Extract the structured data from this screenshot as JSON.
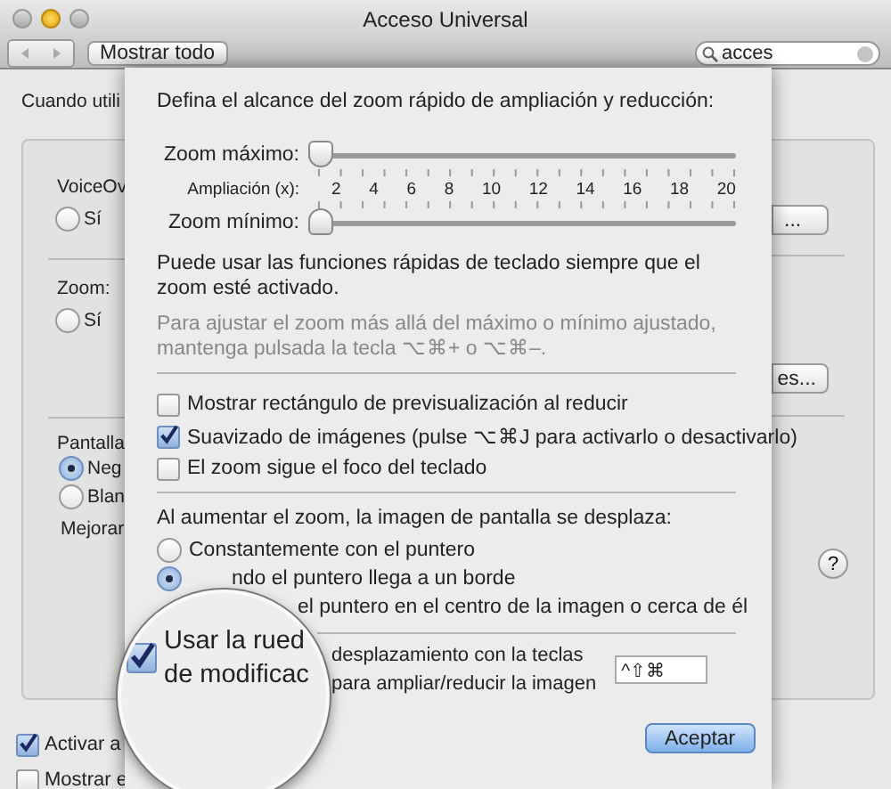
{
  "window": {
    "title": "Acceso Universal"
  },
  "toolbar": {
    "show_all_button": "Mostrar todo",
    "search": {
      "value": "acces"
    }
  },
  "background": {
    "intro": "Cuando utili",
    "voiceover": {
      "label": "VoiceOv",
      "radio": {
        "label": "Sí",
        "selected": false
      },
      "button": "..."
    },
    "zoom": {
      "label": "Zoom:",
      "radio": {
        "label": "Sí",
        "selected": false
      },
      "button": "es..."
    },
    "display": {
      "label": "Pantalla",
      "radios": [
        {
          "label": "Neg",
          "selected": true
        },
        {
          "label": "Blan",
          "selected": false
        }
      ],
      "enhance_label": "Mejorar"
    },
    "help_button": "?",
    "checkboxes": [
      {
        "label": "Activar a",
        "checked": true
      },
      {
        "label": "Mostrar e",
        "checked": false
      }
    ]
  },
  "sheet": {
    "range_heading": "Defina el alcance del zoom rápido de ampliación y reducción:",
    "sliders": [
      {
        "label": "Zoom máximo:",
        "level": 0
      },
      {
        "label": "Zoom mínimo:",
        "level": 0
      }
    ],
    "scale": {
      "label": "Ampliación (x):",
      "ticks": [
        "2",
        "4",
        "6",
        "8",
        "10",
        "12",
        "14",
        "16",
        "18",
        "20"
      ]
    },
    "note": "Puede usar las funciones rápidas de teclado siempre que el zoom esté activado.",
    "hint": "Para ajustar el zoom más allá del máximo o mínimo ajustado, mantenga pulsada la tecla ⌥⌘+ o ⌥⌘–.",
    "options": [
      {
        "label": "Mostrar rectángulo de previsualización al reducir",
        "checked": false
      },
      {
        "label": "Suavizado de imágenes (pulse ⌥⌘J para activarlo o desactivarlo)",
        "checked": true
      },
      {
        "label": "El zoom sigue el foco del teclado",
        "checked": false
      }
    ],
    "scroll_heading": "Al aumentar el zoom, la imagen de pantalla se desplaza:",
    "scroll_modes": [
      {
        "label": "Constantemente con el puntero",
        "selected": false
      },
      {
        "label": "ndo el puntero llega a un borde",
        "selected": true
      }
    ],
    "centered_mode_text": "el puntero en el centro de la imagen o cerca de él",
    "scroll_wheel": {
      "lines": [
        "desplazamiento con la teclas",
        "para ampliar/reducir la imagen"
      ],
      "shortcut": "^⇧⌘"
    },
    "ok_button": "Aceptar"
  },
  "magnifier": {
    "checked": true,
    "lines": [
      "Usar la rued",
      "de modificac"
    ]
  }
}
